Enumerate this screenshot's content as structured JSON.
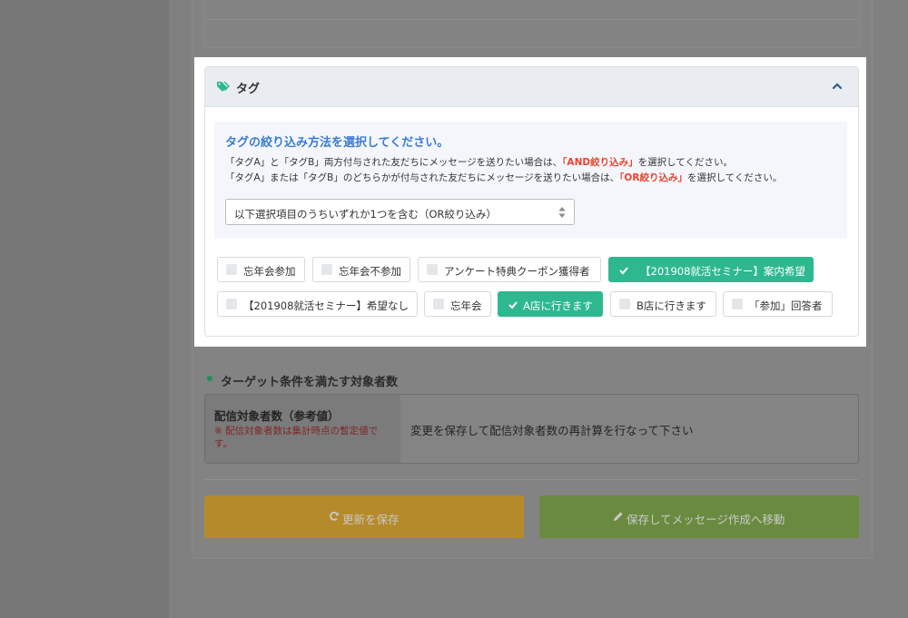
{
  "tag_panel": {
    "title": "タグ",
    "collapse_icon": "chevron-up-icon",
    "instruction_title": "タグの絞り込み方法を選択してください。",
    "line1": {
      "pre": "「タグA」と「タグB」両方付与された友だちにメッセージを送りたい場合は、",
      "em": "「AND絞り込み」",
      "post": "を選択してください。"
    },
    "line2": {
      "pre": "「タグA」または「タグB」のどちらかが付与された友だちにメッセージを送りたい場合は、",
      "em": "「OR絞り込み」",
      "post": "を選択してください。"
    },
    "filter_select": {
      "selected": "以下選択項目のうちいずれか1つを含む（OR絞り込み）"
    },
    "tags": [
      {
        "label": "忘年会参加",
        "checked": false
      },
      {
        "label": "忘年会不参加",
        "checked": false
      },
      {
        "label": "アンケート特典クーポン獲得者",
        "checked": false
      },
      {
        "label": "【201908就活セミナー】案内希望",
        "checked": true
      },
      {
        "label": "【201908就活セミナー】希望なし",
        "checked": false
      },
      {
        "label": "忘年会",
        "checked": false
      },
      {
        "label": "A店に行きます",
        "checked": true
      },
      {
        "label": "B店に行きます",
        "checked": false
      },
      {
        "label": "「参加」回答者",
        "checked": false
      }
    ]
  },
  "target_section": {
    "title": "ターゲット条件を満たす対象者数",
    "label": "配信対象者数（参考値）",
    "note": "※ 配信対象者数は集計時点の暫定値です。",
    "message": "変更を保存して配信対象者数の再計算を行なって下さい"
  },
  "buttons": {
    "save": "更新を保存",
    "save_icon": "refresh-icon",
    "move": "保存してメッセージ作成へ移動",
    "move_icon": "pencil-icon"
  },
  "colors": {
    "accent_green": "#2eb88f",
    "link_blue": "#3a7bd5",
    "emphasis_red": "#e8442f"
  }
}
